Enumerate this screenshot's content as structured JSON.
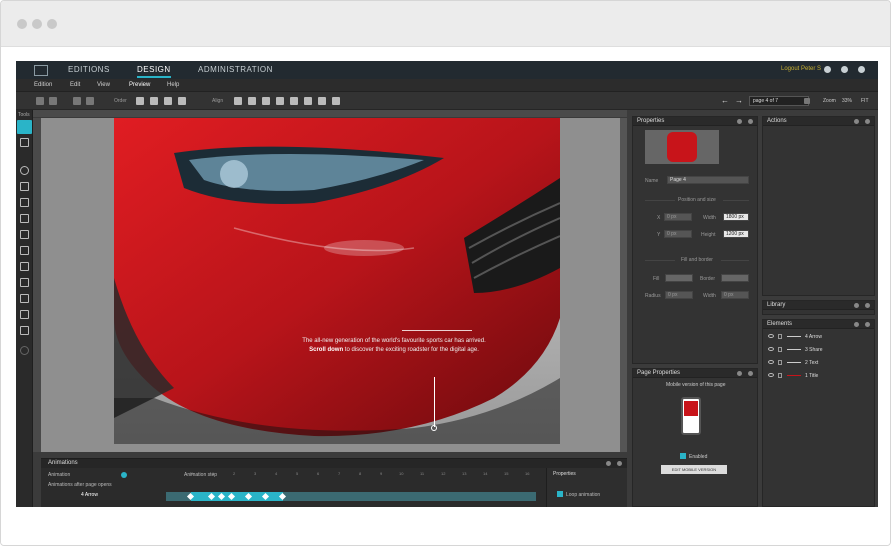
{
  "app": {
    "nav": [
      "EDITIONS",
      "DESIGN",
      "ADMINISTRATION"
    ],
    "active_nav": "DESIGN",
    "user_label": "Logout Peter S"
  },
  "menu": [
    "Edition",
    "Edit",
    "View",
    "Preview",
    "Help"
  ],
  "toolbar": {
    "order_label": "Order",
    "align_label": "Align",
    "page_select": "page 4 of 7",
    "zoom_label": "Zoom",
    "zoom_value": "33%",
    "fit_label": "FIT"
  },
  "tools": {
    "title": "Tools"
  },
  "page_content": {
    "body_line1": "The all-new generation of the world's favourite sports car has arrived.",
    "body_line2_bold": "Scroll down",
    "body_line2_rest": "to discover the exciting roadster for the digital age."
  },
  "properties": {
    "title": "Properties",
    "name_label": "Name",
    "name_value": "Page 4",
    "position_size": "Position and size",
    "x_label": "X",
    "y_label": "Y",
    "width_label": "Width",
    "height_label": "Height",
    "width_value": "1800 px",
    "height_value": "1200 px",
    "x_value": "0 px",
    "y_value": "0 px",
    "fill_border": "Fill and border",
    "fill_label": "Fill",
    "border_label": "Border",
    "radius_label": "Radius",
    "width2_label": "Width",
    "radius_value": "0 px",
    "width2_value": "0 px"
  },
  "actions": {
    "title": "Actions"
  },
  "library": {
    "title": "Library"
  },
  "elements": {
    "title": "Elements",
    "items": [
      "4 Arrow",
      "3 Share",
      "2 Text",
      "1 Title"
    ]
  },
  "page_properties": {
    "title": "Page Properties",
    "mobile_label": "Mobile version of this page",
    "enabled_label": "Enabled",
    "edit_button": "EDIT MOBILE VERSION"
  },
  "animations": {
    "title": "Animations",
    "animation_label": "Animation",
    "step_label": "Animation step",
    "after_open": "Animations after page opens",
    "row_label": "4 Arrow",
    "ticks": [
      "0",
      "1",
      "2",
      "3",
      "4",
      "5",
      "6",
      "7",
      "8",
      "9",
      "10",
      "11",
      "12",
      "13",
      "14",
      "15",
      "16",
      "17"
    ],
    "props_title": "Properties",
    "loop_label": "Loop animation"
  },
  "colors": {
    "accent": "#2ab4c8",
    "car_red": "#c8141a",
    "bg_dark": "#3b3b3b"
  }
}
